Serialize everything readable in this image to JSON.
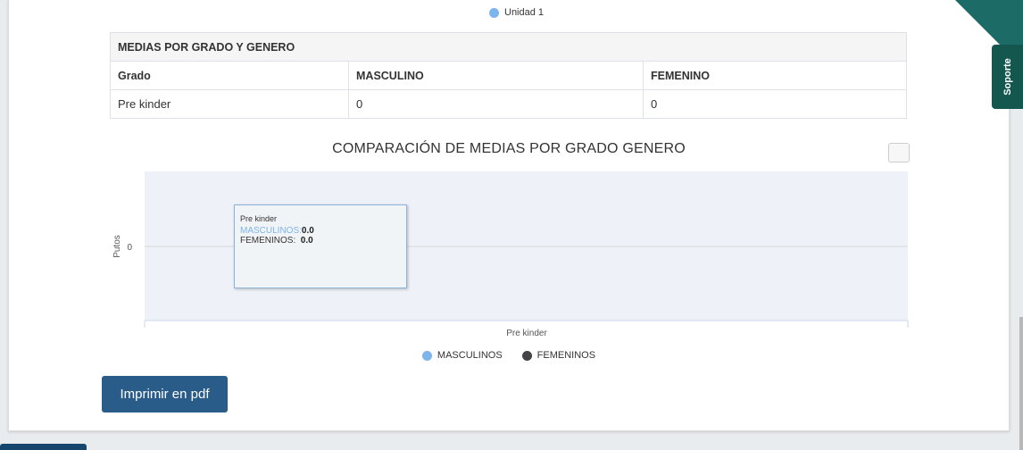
{
  "top_legend": {
    "label": "Unidad 1",
    "color": "#7cb5ec"
  },
  "table": {
    "caption": "MEDIAS POR GRADO Y GENERO",
    "headers": [
      "Grado",
      "MASCULINO",
      "FEMENINO"
    ],
    "rows": [
      [
        "Pre kinder",
        "0",
        "0"
      ]
    ]
  },
  "chart": {
    "title": "COMPARACIÓN DE MEDIAS POR GRADO GENERO"
  },
  "chart_data": {
    "type": "bar",
    "title": "COMPARACIÓN DE MEDIAS POR GRADO GENERO",
    "categories": [
      "Pre kinder"
    ],
    "series": [
      {
        "name": "MASCULINOS",
        "values": [
          0.0
        ],
        "color": "#7cb5ec"
      },
      {
        "name": "FEMENINOS",
        "values": [
          0.0
        ],
        "color": "#434348"
      }
    ],
    "ylabel": "Putos",
    "yticks": [
      "0"
    ],
    "xlabel": "",
    "legend": "bottom-center",
    "grid": true
  },
  "tooltip": {
    "header": "Pre kinder",
    "rows": [
      {
        "label": "MASCULINOS:",
        "value": "0.0"
      },
      {
        "label": "FEMENINOS:",
        "value": "0.0"
      }
    ]
  },
  "buttons": {
    "print_pdf": "Imprimir en pdf"
  },
  "side": {
    "support": "Soporte"
  },
  "icons": {
    "chart_menu": "chart-menu-icon"
  }
}
